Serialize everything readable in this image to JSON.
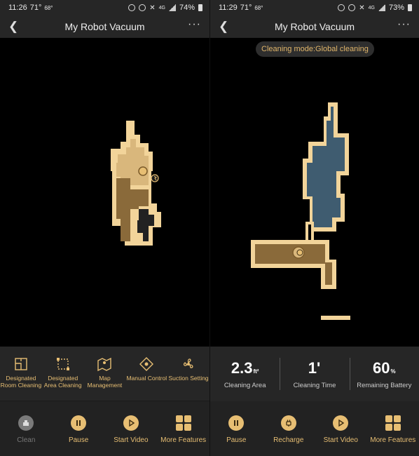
{
  "left": {
    "status": {
      "time": "11:26",
      "temp": "71°",
      "temp_sub": "68°",
      "net": "4G",
      "battery": "74%"
    },
    "title": "My Robot Vacuum",
    "features": [
      {
        "label": "Designated Room Cleaning",
        "icon": "room-icon"
      },
      {
        "label": "Designated Area Cleaning",
        "icon": "area-icon"
      },
      {
        "label": "Map Management",
        "icon": "map-icon"
      },
      {
        "label": "Manual Control",
        "icon": "dpad-icon"
      },
      {
        "label": "Suction Setting",
        "icon": "fan-icon"
      }
    ],
    "actions": [
      {
        "label": "Clean",
        "icon": "clean-icon",
        "disabled": true
      },
      {
        "label": "Pause",
        "icon": "pause-icon"
      },
      {
        "label": "Start Video",
        "icon": "play-icon"
      },
      {
        "label": "More Features",
        "icon": "grid-icon"
      }
    ]
  },
  "right": {
    "status": {
      "time": "11:29",
      "temp": "71°",
      "temp_sub": "68°",
      "net": "4G",
      "battery": "73%"
    },
    "title": "My Robot Vacuum",
    "mode": "Cleaning mode:Global cleaning",
    "stats": [
      {
        "value": "2.3",
        "unit": "ft²",
        "label": "Cleaning Area"
      },
      {
        "value": "1'",
        "unit": "",
        "label": "Cleaning Time"
      },
      {
        "value": "60",
        "unit": "%",
        "label": "Remaining Battery"
      }
    ],
    "actions": [
      {
        "label": "Pause",
        "icon": "pause-icon"
      },
      {
        "label": "Recharge",
        "icon": "plug-icon"
      },
      {
        "label": "Start Video",
        "icon": "play-icon"
      },
      {
        "label": "More Features",
        "icon": "grid-icon"
      }
    ]
  },
  "colors": {
    "accent": "#e7be73",
    "wall": "#f2d49a",
    "room_light": "#d9b77c",
    "room_mid": "#8a6a3a",
    "room_dark": "#2a2a2a",
    "room_blue": "#3f5c70"
  }
}
